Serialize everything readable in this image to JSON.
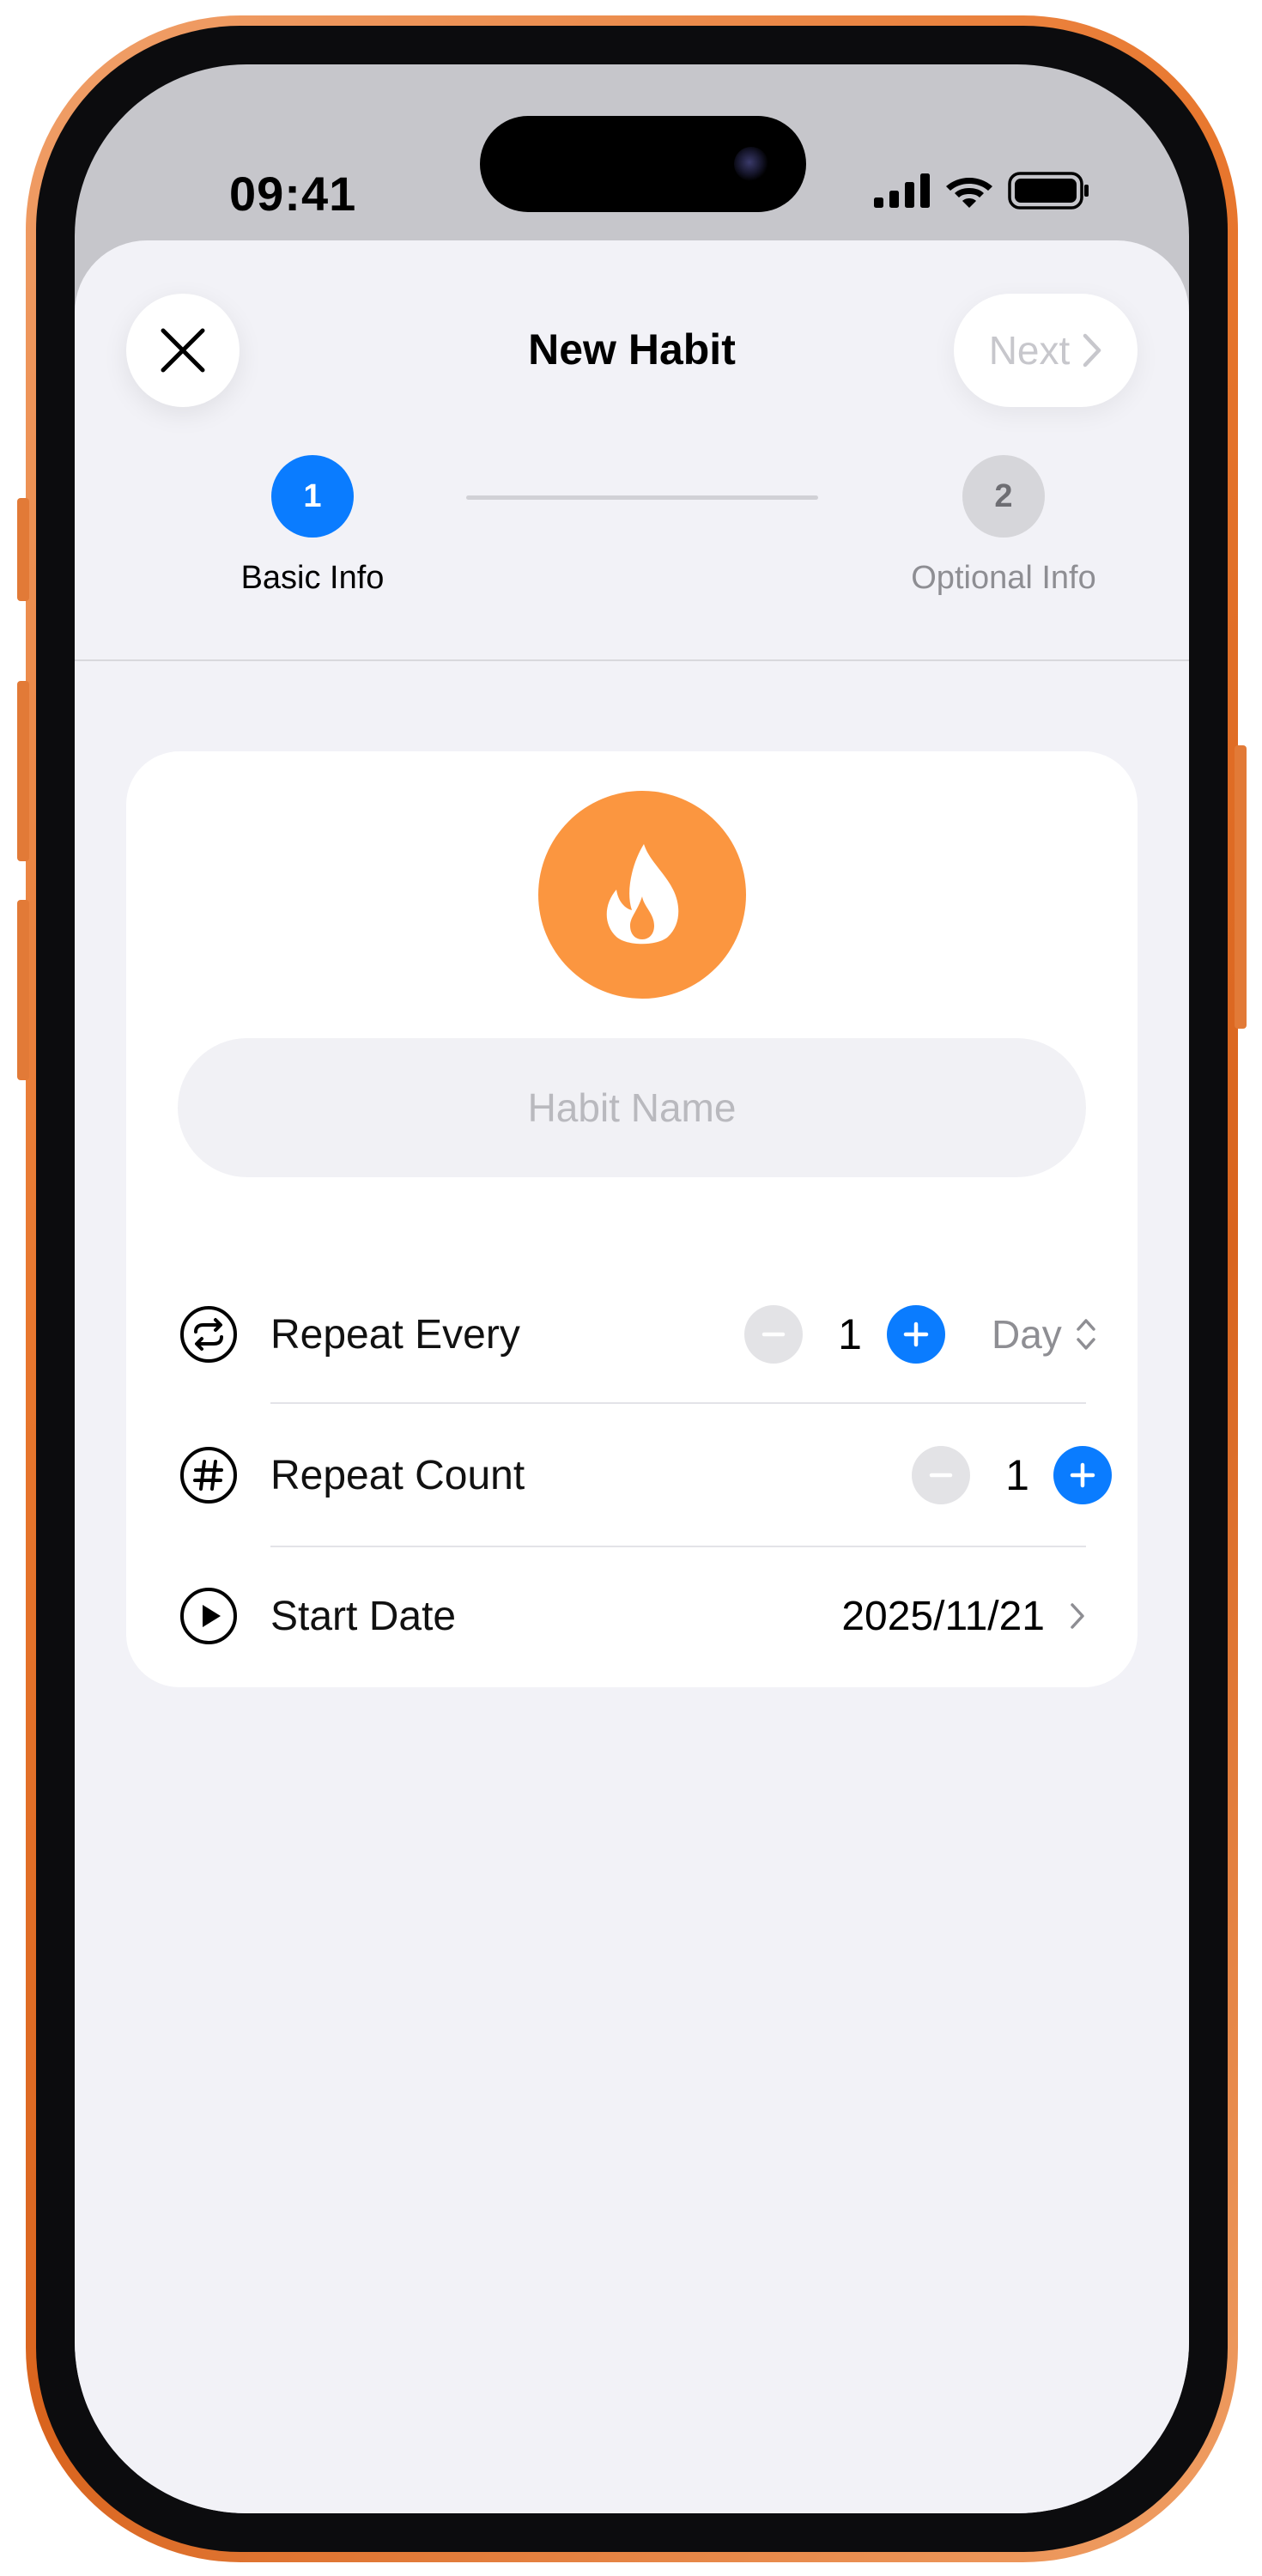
{
  "status_bar": {
    "time": "09:41"
  },
  "nav": {
    "title": "New Habit",
    "next_label": "Next"
  },
  "steps": [
    {
      "number": "1",
      "label": "Basic Info",
      "active": true
    },
    {
      "number": "2",
      "label": "Optional Info",
      "active": false
    }
  ],
  "habit": {
    "icon": "flame-icon",
    "icon_color": "#fb9640",
    "name_placeholder": "Habit Name",
    "name_value": ""
  },
  "fields": {
    "repeat_every": {
      "label": "Repeat Every",
      "value": "1",
      "unit": "Day"
    },
    "repeat_count": {
      "label": "Repeat Count",
      "value": "1"
    },
    "start_date": {
      "label": "Start Date",
      "value": "2025/11/21"
    }
  },
  "colors": {
    "accent": "#0a7cff",
    "frame": "#e8772e",
    "background": "#f2f2f7"
  }
}
